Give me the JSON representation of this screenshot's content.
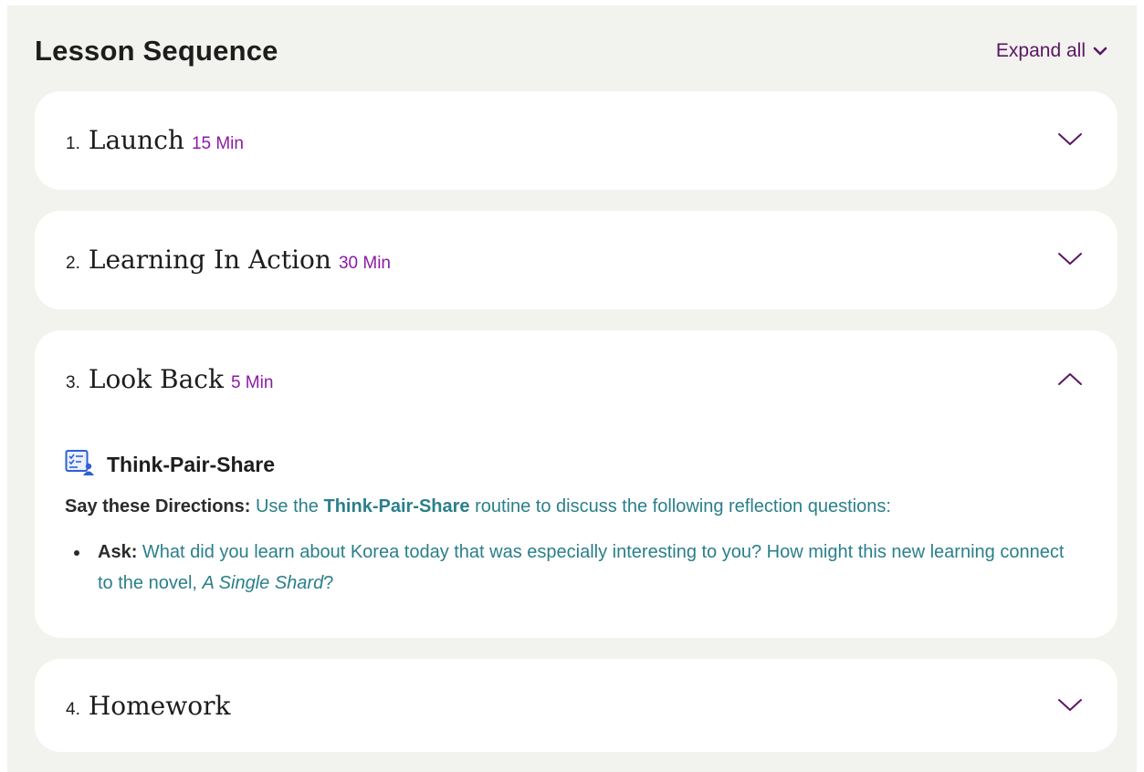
{
  "header": {
    "title": "Lesson Sequence",
    "expand_label": "Expand all"
  },
  "colors": {
    "panel_background": "#f2f2ee",
    "accent_purple": "#5a1663",
    "duration_purple": "#8c1aa5",
    "link_teal": "#2a7f8a",
    "text_dark": "#1d1d1d"
  },
  "sections": [
    {
      "number": "1.",
      "title": "Launch",
      "duration": "15 Min",
      "expanded": false,
      "icon": "chevron-down-icon"
    },
    {
      "number": "2.",
      "title": "Learning In Action",
      "duration": "30 Min",
      "expanded": false,
      "icon": "chevron-down-icon"
    },
    {
      "number": "3.",
      "title": "Look Back",
      "duration": "5 Min",
      "expanded": true,
      "icon": "chevron-up-icon",
      "content": {
        "routine_icon": "checklist-person-icon",
        "routine_label": "Think-Pair-Share",
        "directions_lead": "Say these Directions:",
        "directions_before": "Use the",
        "directions_highlight": "Think-Pair-Share",
        "directions_after": "routine to discuss the following reflection questions:",
        "bullets": [
          {
            "lead": "Ask:",
            "text": "What did you learn about Korea today that was especially interesting to you? How might this new learning connect to the novel,",
            "title_italic": "A Single Shard",
            "end": "?"
          }
        ]
      }
    },
    {
      "number": "4.",
      "title": "Homework",
      "duration": "",
      "expanded": false,
      "icon": "chevron-down-icon"
    }
  ]
}
